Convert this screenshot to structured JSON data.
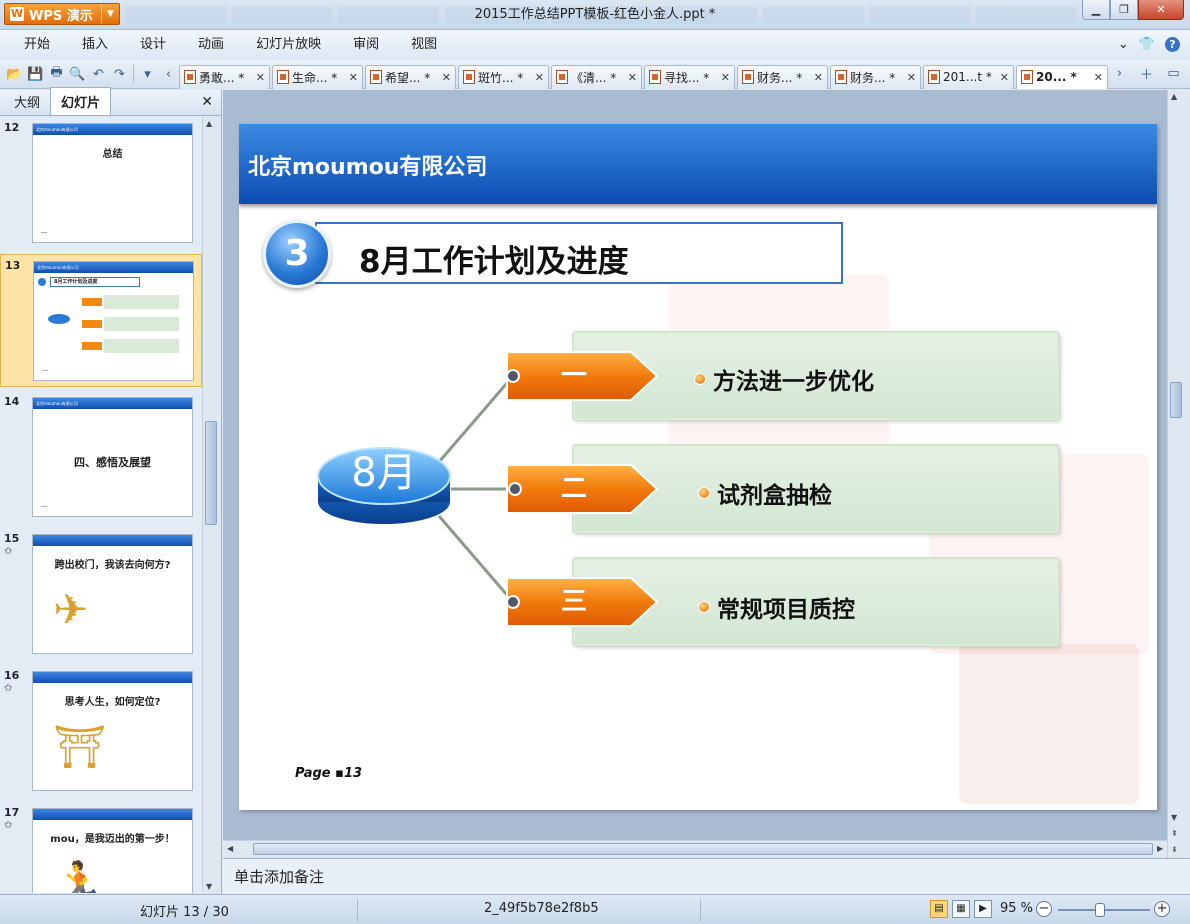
{
  "window": {
    "app_button": "WPS 演示",
    "title": "2015工作总结PPT模板-红色小金人.ppt *",
    "controls": [
      "minimize",
      "maximize",
      "close"
    ]
  },
  "menu": {
    "items": [
      "开始",
      "插入",
      "设计",
      "动画",
      "幻灯片放映",
      "审阅",
      "视图"
    ]
  },
  "doc_tabs": [
    {
      "label": "勇敢... *",
      "active": false
    },
    {
      "label": "生命... *",
      "active": false
    },
    {
      "label": "希望... *",
      "active": false
    },
    {
      "label": "斑竹... *",
      "active": false
    },
    {
      "label": "《清... *",
      "active": false
    },
    {
      "label": "寻找... *",
      "active": false
    },
    {
      "label": "财务... *",
      "active": false
    },
    {
      "label": "财务... *",
      "active": false
    },
    {
      "label": "201...t *",
      "active": false
    },
    {
      "label": "20... *",
      "active": true
    }
  ],
  "left_panel": {
    "tabs": [
      "大纲",
      "幻灯片"
    ],
    "active_tab": "幻灯片",
    "thumbnails": [
      {
        "num": "12",
        "header": "北京moumou有限公司",
        "title": "总结",
        "footer": "---",
        "selected": false,
        "star": false
      },
      {
        "num": "13",
        "header": "北京moumou有限公司",
        "title": "8月工作计划及进度",
        "footer": "---",
        "selected": true,
        "star": false
      },
      {
        "num": "14",
        "header": "北京moumou有限公司",
        "title": "四、感悟及展望",
        "footer": "---",
        "selected": false,
        "star": false
      },
      {
        "num": "15",
        "header": "",
        "title": "跨出校门，我该去向何方?",
        "footer": "",
        "selected": false,
        "star": true
      },
      {
        "num": "16",
        "header": "",
        "title": "思考人生，如何定位?",
        "footer": "",
        "selected": false,
        "star": true
      },
      {
        "num": "17",
        "header": "",
        "title": "mou，是我迈出的第一步！",
        "footer": "",
        "selected": false,
        "star": true
      }
    ]
  },
  "slide": {
    "company": "北京moumou有限公司",
    "section_number": "3",
    "title": "8月工作计划及进度",
    "hub_label": "8月",
    "items": [
      {
        "tag": "一",
        "text": "方法进一步优化"
      },
      {
        "tag": "二",
        "text": "试剂盒抽检"
      },
      {
        "tag": "三",
        "text": "常规项目质控"
      }
    ],
    "page_prefix": "Page",
    "page_number": "13"
  },
  "notes": {
    "placeholder": "单击添加备注"
  },
  "status": {
    "slide_indicator": "幻灯片 13 / 30",
    "file_code": "2_49f5b78e2f8b5",
    "zoom": "95 %"
  },
  "colors": {
    "header_blue": "#0d4cb2",
    "tag_orange": "#f28a12",
    "panel_green": "#d2e6d2",
    "accent_orange": "#e06e0c"
  }
}
